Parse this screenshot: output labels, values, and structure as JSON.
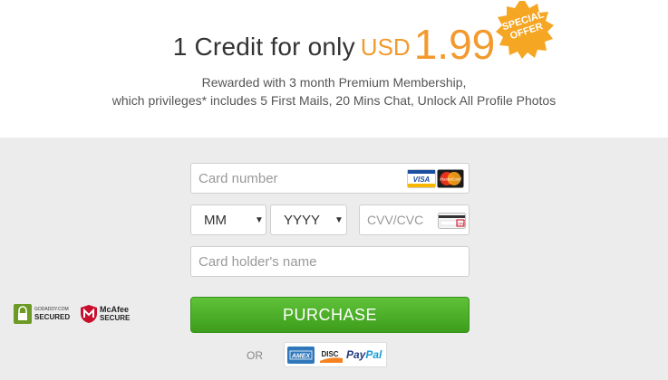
{
  "offer": {
    "headline_prefix": "1 Credit for only",
    "currency": "USD",
    "price": "1.99",
    "badge_line1": "SPECIAL",
    "badge_line2": "OFFER",
    "subtitle_line1": "Rewarded with 3 month Premium Membership,",
    "subtitle_line2": "which privileges* includes 5 First Mails, 20 Mins Chat, Unlock All Profile Photos",
    "accent_color": "#f39a2e"
  },
  "form": {
    "card_number_placeholder": "Card number",
    "month_value": "MM",
    "year_value": "YYYY",
    "cvv_placeholder": "CVV/CVC",
    "holder_placeholder": "Card holder's name",
    "purchase_label": "PURCHASE",
    "or_label": "OR",
    "button_color": "#4caf2a"
  },
  "card_logos": {
    "visa": "VISA",
    "mastercard": "MasterCard",
    "cvv_hint": "CVV"
  },
  "alt_payments": {
    "amex": "AMEX",
    "discover": "DISC",
    "paypal_pay": "Pay",
    "paypal_pal": "Pal"
  },
  "trust_seals": {
    "godaddy_line1": "GODADDY.COM",
    "godaddy_line2": "SECURED",
    "mcafee_line1": "McAfee",
    "mcafee_line2": "SECURE"
  }
}
